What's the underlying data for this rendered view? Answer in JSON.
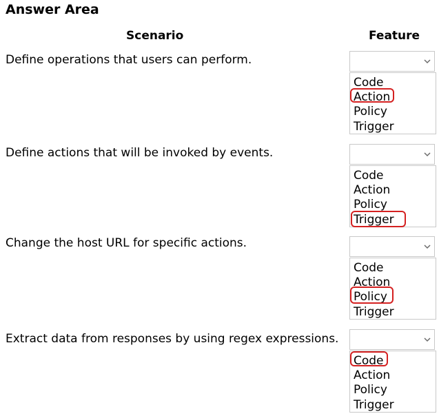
{
  "title": "Answer Area",
  "headers": {
    "scenario": "Scenario",
    "feature": "Feature"
  },
  "rows": [
    {
      "scenario": "Define operations that users can perform.",
      "options": [
        "Code",
        "Action",
        "Policy",
        "Trigger"
      ],
      "selected": "Action"
    },
    {
      "scenario": "Define actions that will be invoked by events.",
      "options": [
        "Code",
        "Action",
        "Policy",
        "Trigger"
      ],
      "selected": "Trigger"
    },
    {
      "scenario": "Change the host URL for specific actions.",
      "options": [
        "Code",
        "Action",
        "Policy",
        "Trigger"
      ],
      "selected": "Policy"
    },
    {
      "scenario": "Extract data from responses by using regex expressions.",
      "options": [
        "Code",
        "Action",
        "Policy",
        "Trigger"
      ],
      "selected": "Code"
    }
  ],
  "icons": {
    "dropdown": "chevron-down-icon"
  },
  "colors": {
    "highlight": "#d42020",
    "border": "#c8c8c8",
    "text": "#000000"
  }
}
